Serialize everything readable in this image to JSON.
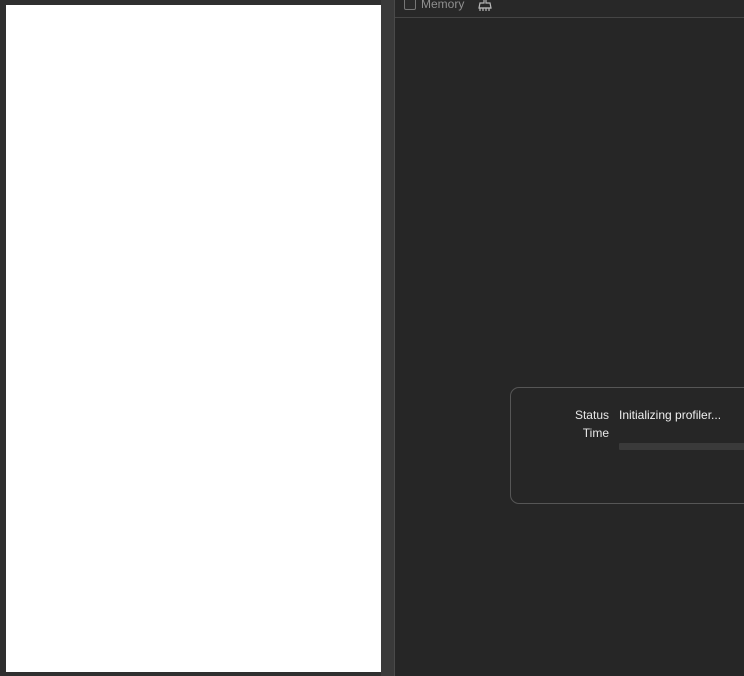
{
  "toolbar": {
    "memory_label": "Memory",
    "memory_checked": false,
    "icon": "broom-icon"
  },
  "profiler": {
    "status_label": "Status",
    "status_value": "Initializing profiler...",
    "time_label": "Time",
    "time_value": "",
    "progress_fraction": 0
  },
  "colors": {
    "background": "#262626",
    "viewport": "#ffffff",
    "border": "#565656",
    "text": "#f0f0f0",
    "muted_text": "#8f8f8f"
  }
}
